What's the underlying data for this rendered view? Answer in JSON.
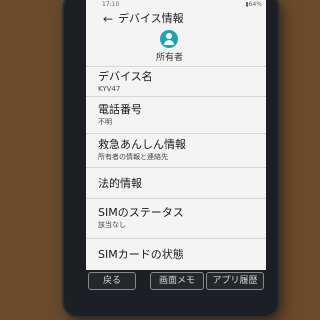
{
  "status": {
    "time": "17:10",
    "battery": "▮64%"
  },
  "appbar": {
    "title": "デバイス情報",
    "back_icon": "arrow-back-icon"
  },
  "owner": {
    "label": "所有者",
    "icon": "person-icon"
  },
  "items": [
    {
      "title": "デバイス名",
      "subtitle": "KYV47"
    },
    {
      "title": "電話番号",
      "subtitle": "不明"
    },
    {
      "title": "救急あんしん情報",
      "subtitle": "所有者の情報と連絡先"
    },
    {
      "title": "法的情報",
      "subtitle": ""
    },
    {
      "title": "SIMのステータス",
      "subtitle": "該当なし"
    },
    {
      "title": "SIMカードの状態",
      "subtitle": ""
    }
  ],
  "navbar": {
    "back": "戻る",
    "memo": "画面メモ",
    "history": "アプリ履歴"
  },
  "colors": {
    "accent": "#1aa6b7",
    "screen_bg": "#f4f4f4",
    "phone_body": "#1c1f24"
  }
}
